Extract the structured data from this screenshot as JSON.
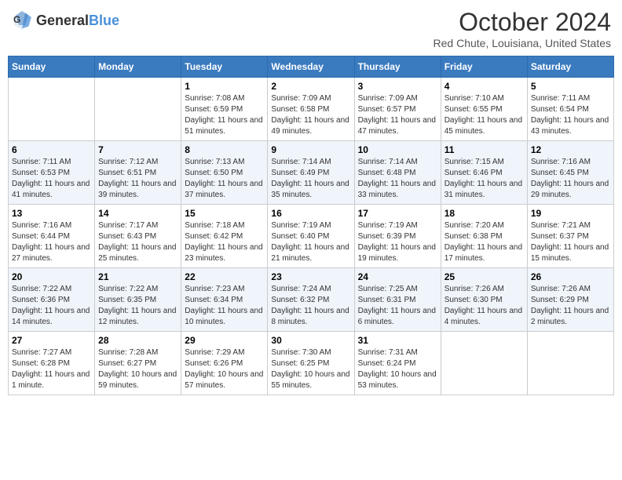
{
  "header": {
    "logo_general": "General",
    "logo_blue": "Blue",
    "month": "October 2024",
    "location": "Red Chute, Louisiana, United States"
  },
  "days_of_week": [
    "Sunday",
    "Monday",
    "Tuesday",
    "Wednesday",
    "Thursday",
    "Friday",
    "Saturday"
  ],
  "weeks": [
    [
      {
        "day": "",
        "sunrise": "",
        "sunset": "",
        "daylight": ""
      },
      {
        "day": "",
        "sunrise": "",
        "sunset": "",
        "daylight": ""
      },
      {
        "day": "1",
        "sunrise": "Sunrise: 7:08 AM",
        "sunset": "Sunset: 6:59 PM",
        "daylight": "Daylight: 11 hours and 51 minutes."
      },
      {
        "day": "2",
        "sunrise": "Sunrise: 7:09 AM",
        "sunset": "Sunset: 6:58 PM",
        "daylight": "Daylight: 11 hours and 49 minutes."
      },
      {
        "day": "3",
        "sunrise": "Sunrise: 7:09 AM",
        "sunset": "Sunset: 6:57 PM",
        "daylight": "Daylight: 11 hours and 47 minutes."
      },
      {
        "day": "4",
        "sunrise": "Sunrise: 7:10 AM",
        "sunset": "Sunset: 6:55 PM",
        "daylight": "Daylight: 11 hours and 45 minutes."
      },
      {
        "day": "5",
        "sunrise": "Sunrise: 7:11 AM",
        "sunset": "Sunset: 6:54 PM",
        "daylight": "Daylight: 11 hours and 43 minutes."
      }
    ],
    [
      {
        "day": "6",
        "sunrise": "Sunrise: 7:11 AM",
        "sunset": "Sunset: 6:53 PM",
        "daylight": "Daylight: 11 hours and 41 minutes."
      },
      {
        "day": "7",
        "sunrise": "Sunrise: 7:12 AM",
        "sunset": "Sunset: 6:51 PM",
        "daylight": "Daylight: 11 hours and 39 minutes."
      },
      {
        "day": "8",
        "sunrise": "Sunrise: 7:13 AM",
        "sunset": "Sunset: 6:50 PM",
        "daylight": "Daylight: 11 hours and 37 minutes."
      },
      {
        "day": "9",
        "sunrise": "Sunrise: 7:14 AM",
        "sunset": "Sunset: 6:49 PM",
        "daylight": "Daylight: 11 hours and 35 minutes."
      },
      {
        "day": "10",
        "sunrise": "Sunrise: 7:14 AM",
        "sunset": "Sunset: 6:48 PM",
        "daylight": "Daylight: 11 hours and 33 minutes."
      },
      {
        "day": "11",
        "sunrise": "Sunrise: 7:15 AM",
        "sunset": "Sunset: 6:46 PM",
        "daylight": "Daylight: 11 hours and 31 minutes."
      },
      {
        "day": "12",
        "sunrise": "Sunrise: 7:16 AM",
        "sunset": "Sunset: 6:45 PM",
        "daylight": "Daylight: 11 hours and 29 minutes."
      }
    ],
    [
      {
        "day": "13",
        "sunrise": "Sunrise: 7:16 AM",
        "sunset": "Sunset: 6:44 PM",
        "daylight": "Daylight: 11 hours and 27 minutes."
      },
      {
        "day": "14",
        "sunrise": "Sunrise: 7:17 AM",
        "sunset": "Sunset: 6:43 PM",
        "daylight": "Daylight: 11 hours and 25 minutes."
      },
      {
        "day": "15",
        "sunrise": "Sunrise: 7:18 AM",
        "sunset": "Sunset: 6:42 PM",
        "daylight": "Daylight: 11 hours and 23 minutes."
      },
      {
        "day": "16",
        "sunrise": "Sunrise: 7:19 AM",
        "sunset": "Sunset: 6:40 PM",
        "daylight": "Daylight: 11 hours and 21 minutes."
      },
      {
        "day": "17",
        "sunrise": "Sunrise: 7:19 AM",
        "sunset": "Sunset: 6:39 PM",
        "daylight": "Daylight: 11 hours and 19 minutes."
      },
      {
        "day": "18",
        "sunrise": "Sunrise: 7:20 AM",
        "sunset": "Sunset: 6:38 PM",
        "daylight": "Daylight: 11 hours and 17 minutes."
      },
      {
        "day": "19",
        "sunrise": "Sunrise: 7:21 AM",
        "sunset": "Sunset: 6:37 PM",
        "daylight": "Daylight: 11 hours and 15 minutes."
      }
    ],
    [
      {
        "day": "20",
        "sunrise": "Sunrise: 7:22 AM",
        "sunset": "Sunset: 6:36 PM",
        "daylight": "Daylight: 11 hours and 14 minutes."
      },
      {
        "day": "21",
        "sunrise": "Sunrise: 7:22 AM",
        "sunset": "Sunset: 6:35 PM",
        "daylight": "Daylight: 11 hours and 12 minutes."
      },
      {
        "day": "22",
        "sunrise": "Sunrise: 7:23 AM",
        "sunset": "Sunset: 6:34 PM",
        "daylight": "Daylight: 11 hours and 10 minutes."
      },
      {
        "day": "23",
        "sunrise": "Sunrise: 7:24 AM",
        "sunset": "Sunset: 6:32 PM",
        "daylight": "Daylight: 11 hours and 8 minutes."
      },
      {
        "day": "24",
        "sunrise": "Sunrise: 7:25 AM",
        "sunset": "Sunset: 6:31 PM",
        "daylight": "Daylight: 11 hours and 6 minutes."
      },
      {
        "day": "25",
        "sunrise": "Sunrise: 7:26 AM",
        "sunset": "Sunset: 6:30 PM",
        "daylight": "Daylight: 11 hours and 4 minutes."
      },
      {
        "day": "26",
        "sunrise": "Sunrise: 7:26 AM",
        "sunset": "Sunset: 6:29 PM",
        "daylight": "Daylight: 11 hours and 2 minutes."
      }
    ],
    [
      {
        "day": "27",
        "sunrise": "Sunrise: 7:27 AM",
        "sunset": "Sunset: 6:28 PM",
        "daylight": "Daylight: 11 hours and 1 minute."
      },
      {
        "day": "28",
        "sunrise": "Sunrise: 7:28 AM",
        "sunset": "Sunset: 6:27 PM",
        "daylight": "Daylight: 10 hours and 59 minutes."
      },
      {
        "day": "29",
        "sunrise": "Sunrise: 7:29 AM",
        "sunset": "Sunset: 6:26 PM",
        "daylight": "Daylight: 10 hours and 57 minutes."
      },
      {
        "day": "30",
        "sunrise": "Sunrise: 7:30 AM",
        "sunset": "Sunset: 6:25 PM",
        "daylight": "Daylight: 10 hours and 55 minutes."
      },
      {
        "day": "31",
        "sunrise": "Sunrise: 7:31 AM",
        "sunset": "Sunset: 6:24 PM",
        "daylight": "Daylight: 10 hours and 53 minutes."
      },
      {
        "day": "",
        "sunrise": "",
        "sunset": "",
        "daylight": ""
      },
      {
        "day": "",
        "sunrise": "",
        "sunset": "",
        "daylight": ""
      }
    ]
  ]
}
